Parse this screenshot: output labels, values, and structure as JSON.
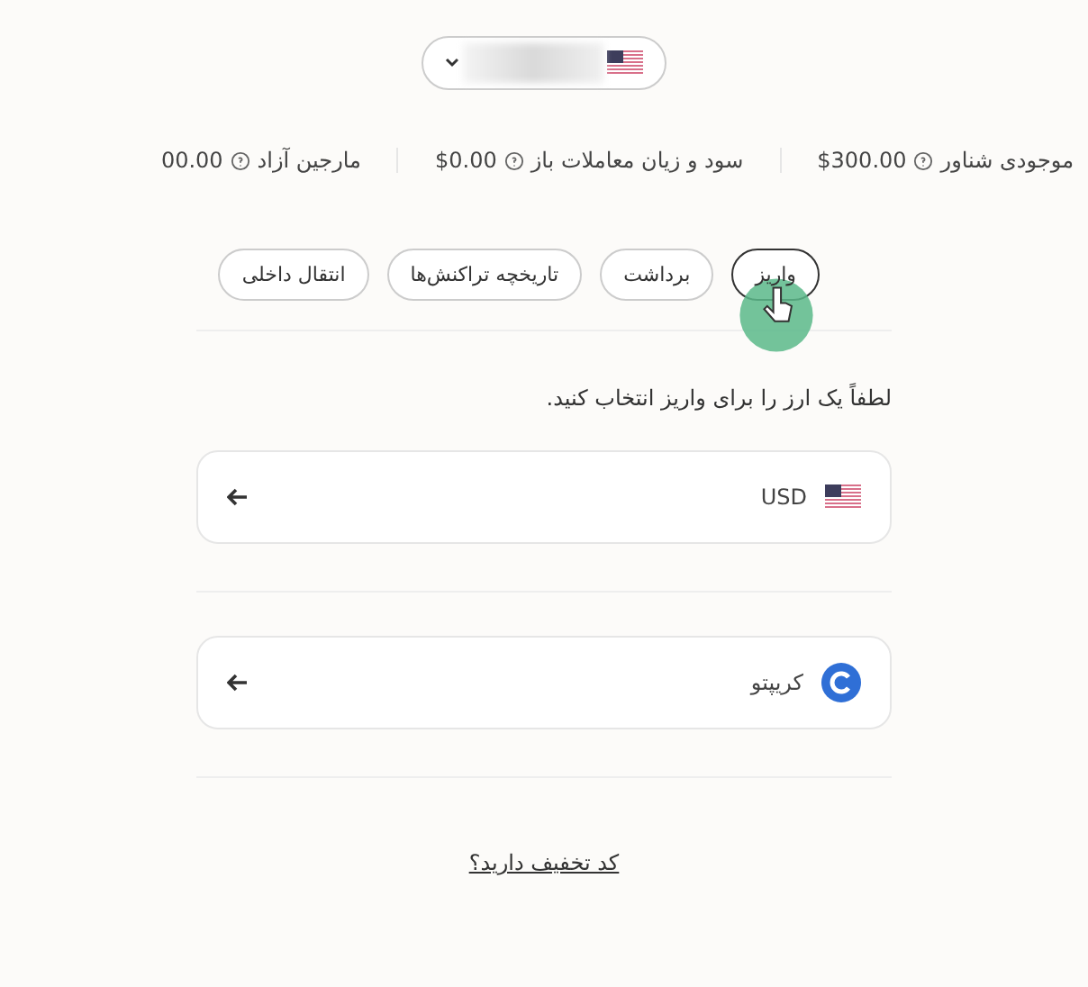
{
  "account_selector": {
    "expanded": false
  },
  "stats": [
    {
      "label": "موجودی شناور",
      "value": "$300.00"
    },
    {
      "label": "سود و زیان معاملات باز",
      "value": "$0.00"
    },
    {
      "label": "مارجین آزاد",
      "value": "00.00"
    }
  ],
  "tabs": [
    {
      "label": "واریز",
      "selected": true
    },
    {
      "label": "برداشت",
      "selected": false
    },
    {
      "label": "تاریخچه تراکنش‌ها",
      "selected": false
    },
    {
      "label": "انتقال داخلی",
      "selected": false
    }
  ],
  "prompt": "لطفاً یک ارز را برای واریز انتخاب کنید.",
  "methods": [
    {
      "kind": "fiat",
      "label": "USD"
    },
    {
      "kind": "crypto",
      "label": "کریپتو"
    }
  ],
  "promo_link": "کد تخفیف دارید؟"
}
